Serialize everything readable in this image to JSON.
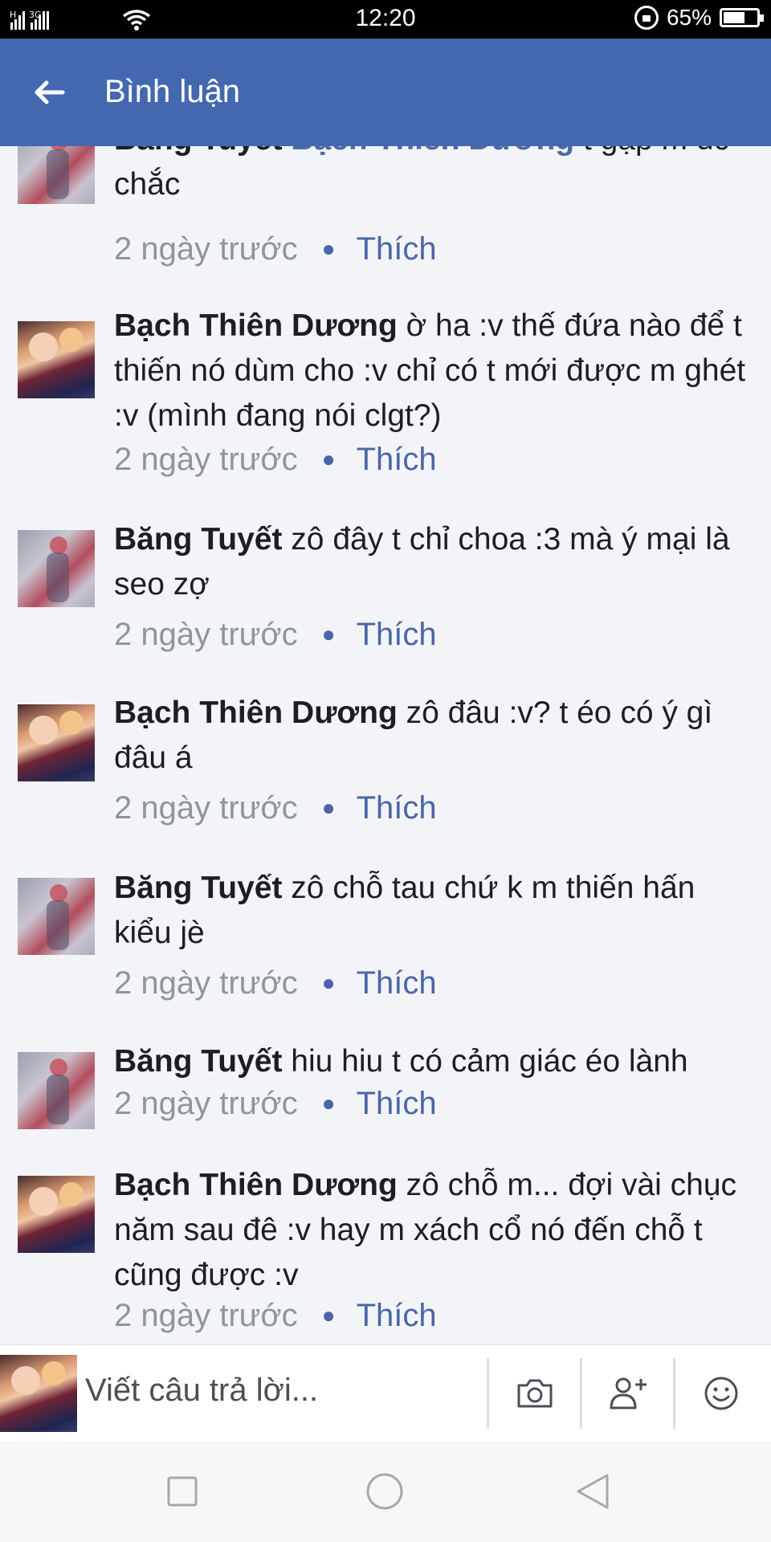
{
  "status_bar": {
    "signal_labels": [
      "H",
      "3G"
    ],
    "time": "12:20",
    "battery_percent": "65%",
    "battery_level": 0.65,
    "icons": [
      "signal-icon",
      "wifi-icon",
      "rotation-lock-icon",
      "battery-icon"
    ]
  },
  "header": {
    "title": "Bình luận",
    "back_icon": "arrow-left-icon",
    "background": "#4368b0"
  },
  "comments": [
    {
      "author": "Băng Tuyết",
      "mention": "Bạch Thiên Dương",
      "text": " t gặp m đc chắc",
      "time": "2 ngày trước",
      "like": "Thích",
      "avatar": "a"
    },
    {
      "author": "Bạch Thiên Dương",
      "mention": "",
      "text": " ờ ha :v thế đứa nào để t thiến nó dùm cho :v chỉ có t mới được m ghét :v (mình đang nói clgt?)",
      "time": "2 ngày trước",
      "like": "Thích",
      "avatar": "b"
    },
    {
      "author": "Băng Tuyết",
      "mention": "",
      "text": " zô đây t chỉ choa :3 mà ý mại là seo zợ",
      "time": "2 ngày trước",
      "like": "Thích",
      "avatar": "a"
    },
    {
      "author": "Bạch Thiên Dương",
      "mention": "",
      "text": " zô đâu :v? t éo có ý gì đâu á",
      "time": "2 ngày trước",
      "like": "Thích",
      "avatar": "b"
    },
    {
      "author": "Băng Tuyết",
      "mention": "",
      "text": " zô chỗ tau chứ k m thiến hấn kiểu jè",
      "time": "2 ngày trước",
      "like": "Thích",
      "avatar": "a"
    },
    {
      "author": "Băng Tuyết",
      "mention": "",
      "text": " hiu hiu t có cảm giác éo lành",
      "time": "2 ngày trước",
      "like": "Thích",
      "avatar": "a"
    },
    {
      "author": "Bạch Thiên Dương",
      "mention": "",
      "text": " zô chỗ m... đợi vài chục năm sau đê :v hay m xách cổ nó đến chỗ t cũng được :v",
      "time": "2 ngày trước",
      "like": "Thích",
      "avatar": "b"
    }
  ],
  "reply_bar": {
    "placeholder": "Viết câu trả lời...",
    "icons": [
      "camera-icon",
      "tag-friend-icon",
      "emoji-icon"
    ]
  },
  "nav_bar": {
    "icons": [
      "recent-apps-icon",
      "home-icon",
      "back-triangle-icon"
    ]
  },
  "colors": {
    "link_blue": "#4a66a8",
    "meta_gray": "#90949c",
    "list_background": "#f3f4f7"
  }
}
